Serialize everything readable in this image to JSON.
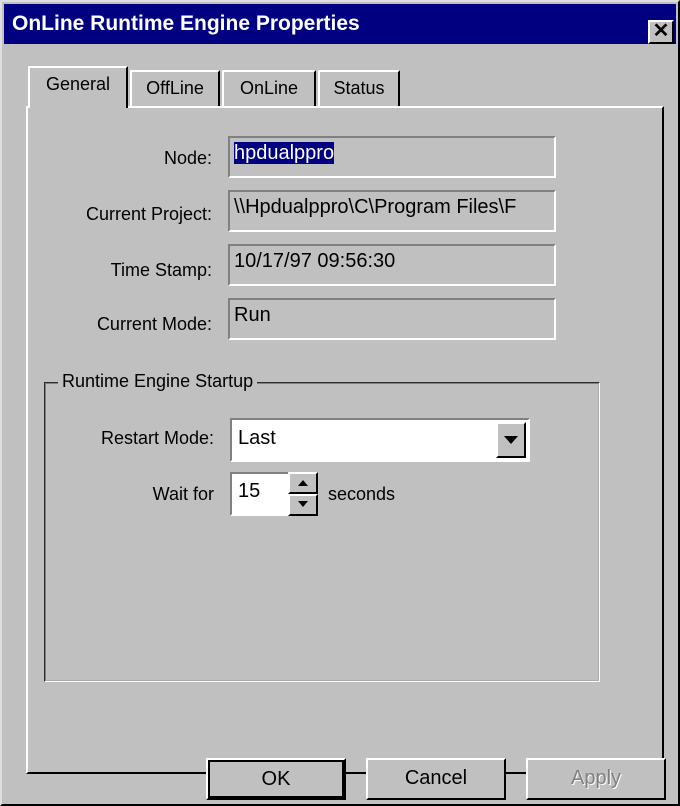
{
  "window": {
    "title": "OnLine Runtime Engine Properties",
    "close_glyph": "✕"
  },
  "tabs": [
    {
      "label": "General",
      "active": true
    },
    {
      "label": "OffLine",
      "active": false
    },
    {
      "label": "OnLine",
      "active": false
    },
    {
      "label": "Status",
      "active": false
    }
  ],
  "general": {
    "node_label": "Node:",
    "node_value": "hpdualppro",
    "project_label": "Current Project:",
    "project_value": "\\\\Hpdualppro\\C\\Program Files\\F",
    "timestamp_label": "Time Stamp:",
    "timestamp_value": "10/17/97 09:56:30",
    "mode_label": "Current Mode:",
    "mode_value": "Run"
  },
  "startup": {
    "group_title": "Runtime Engine Startup",
    "restart_label": "Restart Mode:",
    "restart_value": "Last",
    "wait_label": "Wait for",
    "wait_value": "15",
    "wait_unit": "seconds"
  },
  "buttons": {
    "ok": "OK",
    "cancel": "Cancel",
    "apply": "Apply"
  },
  "icons": {
    "dropdown": "chevron-down-icon",
    "spin_up": "triangle-up-icon",
    "spin_down": "triangle-down-icon"
  },
  "colors": {
    "titlebar": "#000080",
    "face": "#c0c0c0",
    "selection": "#000080"
  }
}
